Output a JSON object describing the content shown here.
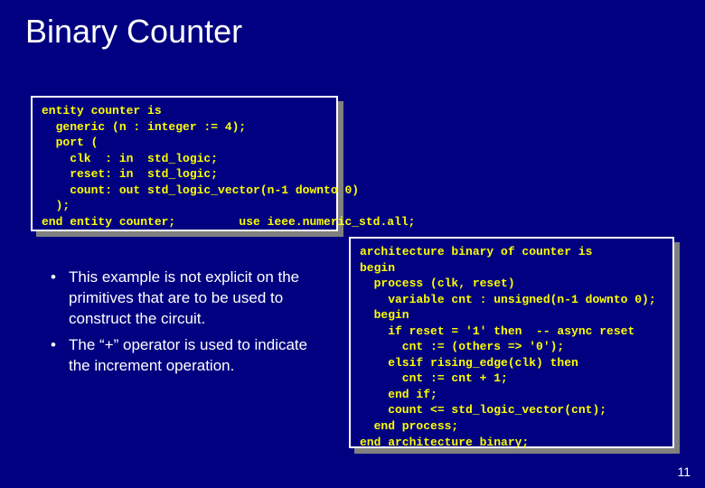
{
  "title": "Binary Counter",
  "entity_code": "entity counter is\n  generic (n : integer := 4);\n  port (\n    clk  : in  std_logic;\n    reset: in  std_logic;\n    count: out std_logic_vector(n-1 downto 0)\n  );\nend entity counter;         use ieee.numeric_std.all;",
  "arch_code": "architecture binary of counter is\nbegin\n  process (clk, reset)\n    variable cnt : unsigned(n-1 downto 0);\n  begin\n    if reset = '1' then  -- async reset\n      cnt := (others => '0');\n    elsif rising_edge(clk) then\n      cnt := cnt + 1;\n    end if;\n    count <= std_logic_vector(cnt);\n  end process;\nend architecture binary;",
  "bullets": [
    "This example is not explicit on the primitives that are to be used to construct the circuit.",
    "The “+” operator is used to indicate the increment operation."
  ],
  "page_number": "11"
}
